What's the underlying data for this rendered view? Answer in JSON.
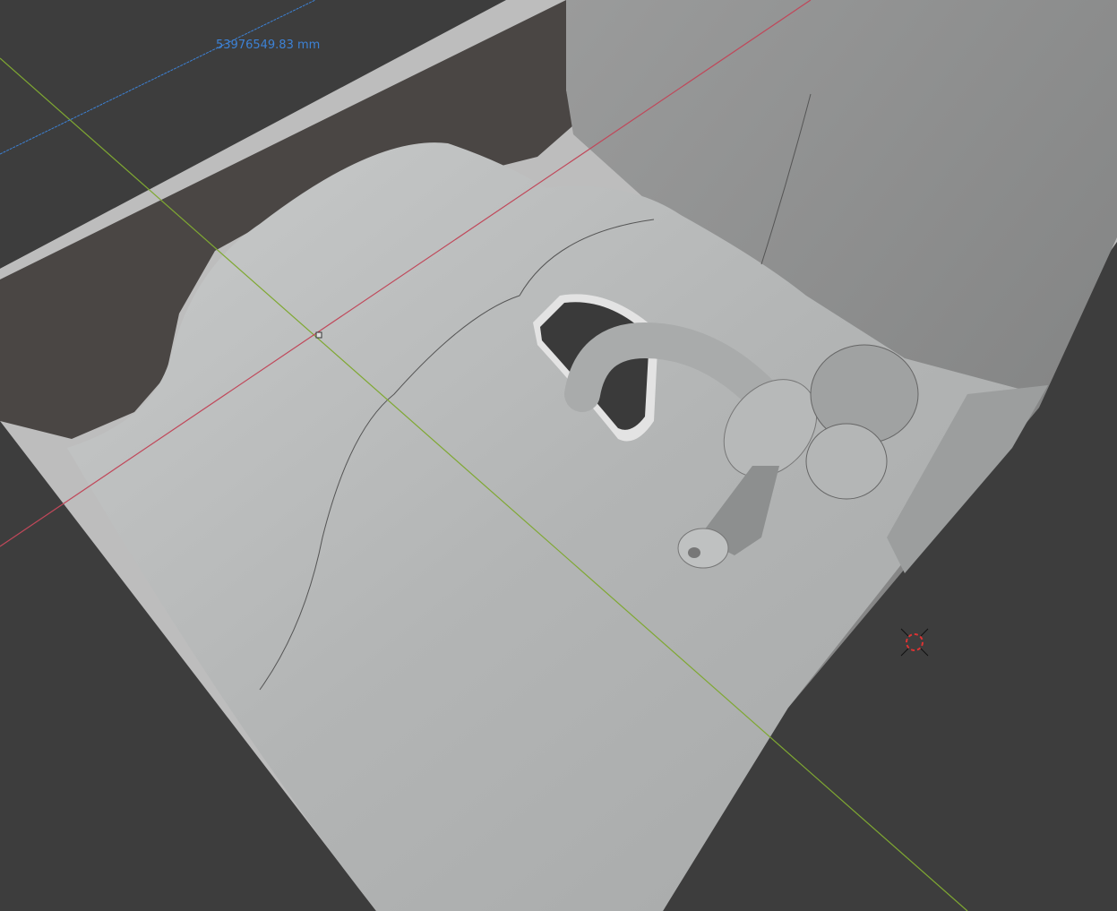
{
  "viewport": {
    "measurement_label": "53976549.83 mm",
    "colors": {
      "background": "#3d3d3d",
      "x_axis": "#c0485a",
      "y_axis": "#7fa832",
      "measure_line": "#3d82d6",
      "model": "#b9bbbb"
    }
  }
}
